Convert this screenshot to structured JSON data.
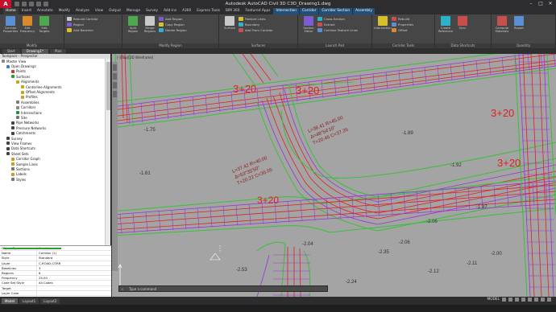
{
  "window": {
    "title": "Autodesk AutoCAD Civil 3D   C3D_Drawing1.dwg"
  },
  "ribbon_tabs": [
    "Home",
    "Insert",
    "Annotate",
    "Modify",
    "Analyze",
    "View",
    "Output",
    "Manage",
    "Survey",
    "Add-ins",
    "A360",
    "Express Tools",
    "BIM 360",
    "Featured Apps",
    "Intersection",
    "Corridor",
    "Corridor Section",
    "Assembly"
  ],
  "ribbon_panels": [
    {
      "title": "Modify",
      "big": [
        "Corridor Properties",
        "Edit Frequency",
        "Edit Targets"
      ],
      "small": []
    },
    {
      "title": "",
      "big": [],
      "small": [
        "Rebuild Corridor",
        "Region",
        "Add Baseline"
      ]
    },
    {
      "title": "Modify Region",
      "big": [
        "Split Region",
        "Merge Regions"
      ],
      "small": [
        "Add Region",
        "Copy Region",
        "Delete Region"
      ]
    },
    {
      "title": "Surfaces",
      "big": [
        "Surface"
      ],
      "small": [
        "Feature Lines",
        "Boundary",
        "Add From Corridor"
      ]
    },
    {
      "title": "Launch Pad",
      "big": [
        "Section Editor"
      ],
      "small": [
        "Cross-Section",
        "Extract",
        "Corridor Feature Lines"
      ]
    },
    {
      "title": "Corridor Tools",
      "big": [
        "Intersection"
      ],
      "small": [
        "Rebuild",
        "Properties",
        "Offset"
      ]
    },
    {
      "title": "Data Shortcuts",
      "big": [
        "Create Reference",
        "Sync"
      ],
      "small": []
    },
    {
      "title": "Quantity",
      "big": [
        "Compute Materials",
        "Report"
      ],
      "small": []
    }
  ],
  "doc_tabs": [
    "Start",
    "Drawing1*",
    "Plan"
  ],
  "toolspace": {
    "header": "Toolspace - Prospector",
    "tree": [
      {
        "label": "Master View",
        "indent": 0,
        "color": "#888888"
      },
      {
        "label": "Open Drawings",
        "indent": 1,
        "color": "#3a7bd5"
      },
      {
        "label": "Points",
        "indent": 2,
        "color": "#cc3333"
      },
      {
        "label": "Surfaces",
        "indent": 2,
        "color": "#339933"
      },
      {
        "label": "Alignments",
        "indent": 3,
        "color": "#c8a020"
      },
      {
        "label": "Centerline Alignments",
        "indent": 4,
        "color": "#c8a020"
      },
      {
        "label": "Offset Alignments",
        "indent": 4,
        "color": "#c8a020"
      },
      {
        "label": "Profiles",
        "indent": 4,
        "color": "#c8a020"
      },
      {
        "label": "Assemblies",
        "indent": 3,
        "color": "#7a7a7a"
      },
      {
        "label": "Corridors",
        "indent": 3,
        "color": "#888888"
      },
      {
        "label": "Intersections",
        "indent": 3,
        "color": "#2a8a3a"
      },
      {
        "label": "Site",
        "indent": 3,
        "color": "#777777"
      },
      {
        "label": "Pipe Networks",
        "indent": 2,
        "color": "#444444"
      },
      {
        "label": "Pressure Networks",
        "indent": 2,
        "color": "#444444"
      },
      {
        "label": "Catchments",
        "indent": 2,
        "color": "#444444"
      },
      {
        "label": "Survey",
        "indent": 1,
        "color": "#444444"
      },
      {
        "label": "View Frames",
        "indent": 1,
        "color": "#444444"
      },
      {
        "label": "Data Shortcuts",
        "indent": 1,
        "color": "#444444"
      },
      {
        "label": "Sheet Sets",
        "indent": 1,
        "color": "#444444"
      },
      {
        "label": "Corridor Graph",
        "indent": 2,
        "color": "#c8a020"
      },
      {
        "label": "Sample Lines",
        "indent": 2,
        "color": "#c8a020"
      },
      {
        "label": "Sections",
        "indent": 2,
        "color": "#777777"
      },
      {
        "label": "Labels",
        "indent": 2,
        "color": "#c8a020"
      },
      {
        "label": "Styles",
        "indent": 2,
        "color": "#777777"
      }
    ]
  },
  "properties": [
    {
      "key": "Object Type",
      "value": "Corridor"
    },
    {
      "key": "Name",
      "value": "Corridor (1)"
    },
    {
      "key": "Style",
      "value": "Standard"
    },
    {
      "key": "Layer",
      "value": "C-ROAD-CORR"
    },
    {
      "key": "Baselines",
      "value": "3"
    },
    {
      "key": "Regions",
      "value": "6"
    },
    {
      "key": "Frequency",
      "value": "25.00"
    },
    {
      "key": "Code Set Style",
      "value": "All Codes"
    },
    {
      "key": "Target",
      "value": ""
    },
    {
      "key": "Layer Color",
      "value": ""
    },
    {
      "key": "Linetype",
      "value": ""
    },
    {
      "key": "Plot Style",
      "value": ""
    }
  ],
  "property_swatches": [
    null,
    null,
    null,
    null,
    null,
    null,
    null,
    null,
    "#2e9e2e",
    "#2e9e2e",
    "#c42020",
    "#2e9e2e"
  ],
  "drawing": {
    "view_label": "[-][Top][2D Wireframe]",
    "command_prompt": "Type a command",
    "labels": {
      "station_1": "3+20",
      "station_2": "3+20",
      "station_3": "3+20",
      "station_4": "3+20",
      "station_5": "3+20",
      "curve_1": "L=38.41  R=45.00",
      "curve_2": "Δ=48°54'10\"",
      "curve_3": "T=20.46  C=37.26",
      "curve_4": "L=37.42  R=40.00",
      "curve_5": "Δ=53°35'50\"",
      "curve_6": "T=20.22  C=36.05",
      "elev_1": "-1.75",
      "elev_2": "-2.06",
      "elev_3": "-2.06",
      "elev_4": "-1.97",
      "elev_5": "-2.35",
      "elev_6": "-2.11",
      "elev_7": "-2.04",
      "elev_8": "-1.89",
      "elev_9": "-2.24",
      "elev_10": "-2.53",
      "elev_11": "-1.61",
      "elev_12": "-1.92",
      "elev_13": "-2.00",
      "elev_14": "-2.12"
    }
  },
  "layout_tabs": [
    "Model",
    "Layout1",
    "Layout2"
  ],
  "status": {
    "mode": "MODEL"
  },
  "colors": {
    "road_green": "#39c039",
    "road_red": "#e02020",
    "road_purple": "#9a32d8",
    "ground": "#a4a4a4"
  }
}
